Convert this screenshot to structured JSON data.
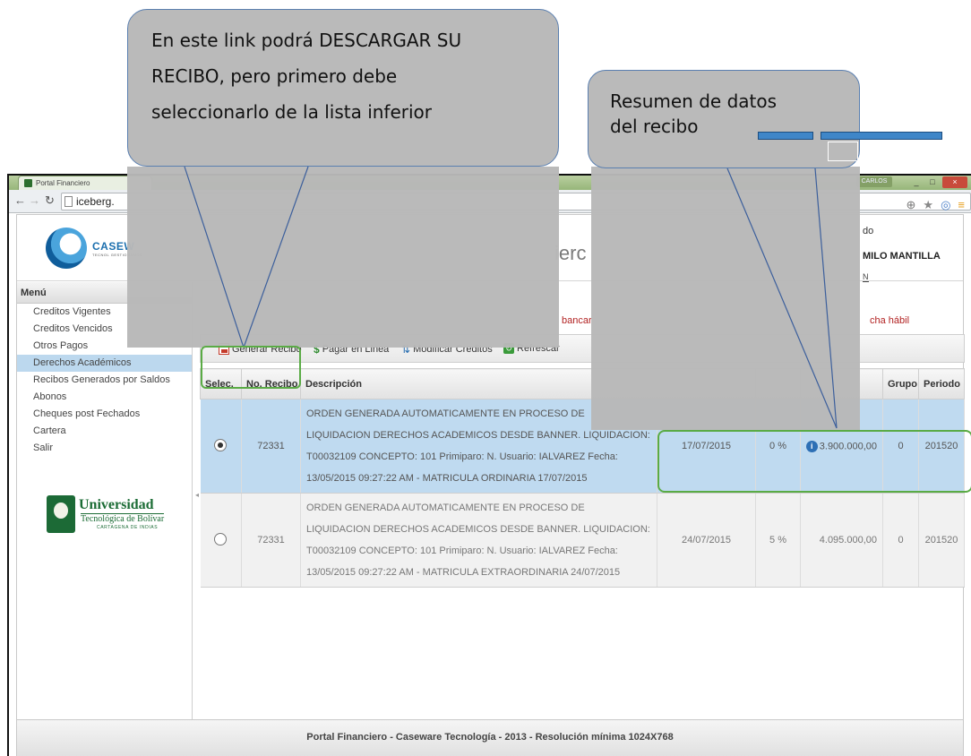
{
  "callouts": {
    "download_lines": [
      "En este link podrá DESCARGAR SU",
      "RECIBO, pero primero debe",
      "seleccionarlo de la lista inferior"
    ],
    "summary_lines": [
      "Resumen de datos",
      "del recibo"
    ]
  },
  "browser": {
    "tab_title": "Portal Financiero",
    "user_pill": "CARLOS",
    "url": "iceberg."
  },
  "header": {
    "logo_text": "CASEW",
    "logo_sub": "TECNOL",
    "logo_tagline": "GESTIONAMOS",
    "title_fragment": "ierc",
    "welcome": "do",
    "user_name": "MILO MANTILLA",
    "user_code": "N"
  },
  "sidebar": {
    "menu_title": "Menú",
    "items": [
      {
        "label": "Creditos Vigentes",
        "active": false
      },
      {
        "label": "Creditos Vencidos",
        "active": false
      },
      {
        "label": "Otros Pagos",
        "active": false
      },
      {
        "label": "Derechos Académicos",
        "active": true
      },
      {
        "label": "Recibos Generados por Saldos",
        "active": false
      },
      {
        "label": "Abonos",
        "active": false
      },
      {
        "label": "Cheques post Fechados",
        "active": false
      },
      {
        "label": "Cartera",
        "active": false
      },
      {
        "label": "Salir",
        "active": false
      }
    ],
    "university": {
      "name": "Universidad",
      "sub": "Tecnológica de Bolívar",
      "city": "CARTAGENA DE INDIAS"
    }
  },
  "notices": {
    "left": "bancar",
    "right": "cha hábil"
  },
  "toolbar": {
    "generate_label": "Generar Recibo",
    "pay_label": "Pagar en Linea",
    "modify_label": "Modificar Creditos",
    "refresh_label": "Refrescar"
  },
  "table": {
    "headers": [
      "Selec.",
      "No. Recibo",
      "Descripción",
      "",
      "",
      "",
      "Grupo",
      "Periodo"
    ],
    "rows": [
      {
        "selected": true,
        "number": "72331",
        "description": "ORDEN GENERADA AUTOMATICAMENTE EN PROCESO DE LIQUIDACION DERECHOS ACADEMICOS DESDE BANNER. LIQUIDACION: T00032109 CONCEPTO: 101 Primiparo: N. Usuario: IALVAREZ Fecha: 13/05/2015 09:27:22 AM - MATRICULA ORDINARIA 17/07/2015",
        "date": "17/07/2015",
        "percent": "0 %",
        "amount": "3.900.000,00",
        "group": "0",
        "period": "201520"
      },
      {
        "selected": false,
        "number": "72331",
        "description": "ORDEN GENERADA AUTOMATICAMENTE EN PROCESO DE LIQUIDACION DERECHOS ACADEMICOS DESDE BANNER. LIQUIDACION: T00032109 CONCEPTO: 101 Primiparo: N. Usuario: IALVAREZ Fecha: 13/05/2015 09:27:22 AM - MATRICULA EXTRAORDINARIA 24/07/2015",
        "date": "24/07/2015",
        "percent": "5 %",
        "amount": "4.095.000,00",
        "group": "0",
        "period": "201520"
      }
    ]
  },
  "footer": {
    "text": "Portal Financiero - Caseware Tecnología - 2013 - Resolución mínima 1024X768"
  },
  "colors": {
    "callout_fill": "#b8b8b8",
    "highlight_green": "#5aab45",
    "selected_row": "#bfdaf0",
    "notice_red": "#b22222"
  }
}
